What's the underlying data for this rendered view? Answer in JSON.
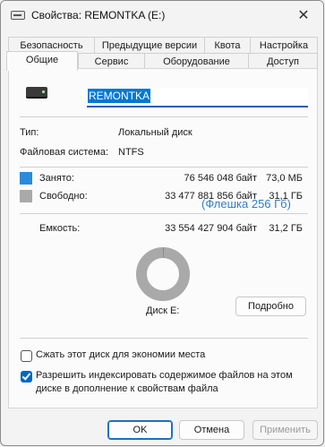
{
  "window": {
    "title": "Свойства: REMONTKA (E:)",
    "close_glyph": "✕"
  },
  "tabs_row1": [
    "Безопасность",
    "Предыдущие версии",
    "Квота",
    "Настройка"
  ],
  "tabs_row2": [
    "Общие",
    "Сервис",
    "Оборудование",
    "Доступ"
  ],
  "active_tab": "Общие",
  "general": {
    "volume_name": "REMONTKA",
    "type_label": "Тип:",
    "type_value": "Локальный диск",
    "fs_label": "Файловая система:",
    "fs_value": "NTFS",
    "used_label": "Занято:",
    "used_bytes": "76 546 048 байт",
    "used_size": "73,0 МБ",
    "free_label": "Свободно:",
    "free_bytes": "33 477 881 856 байт",
    "free_size": "31,1 ГБ",
    "flash_note": "(Флешка 256 Гб)",
    "capacity_label": "Емкость:",
    "capacity_bytes": "33 554 427 904 байт",
    "capacity_size": "31,2 ГБ",
    "disk_label": "Диск E:",
    "details_button": "Подробно",
    "compress_label": "Сжать этот диск для экономии места",
    "compress_checked": false,
    "index_label_line1": "Разрешить индексировать содержимое файлов на этом",
    "index_label_line2": "диске в дополнение к свойствам файла",
    "index_checked": true,
    "used_fraction": 0.0023
  },
  "colors": {
    "used": "#2a8bd8",
    "free": "#a9a9a9",
    "accent": "#0078d4"
  },
  "footer": {
    "ok": "OK",
    "cancel": "Отмена",
    "apply": "Применить"
  }
}
